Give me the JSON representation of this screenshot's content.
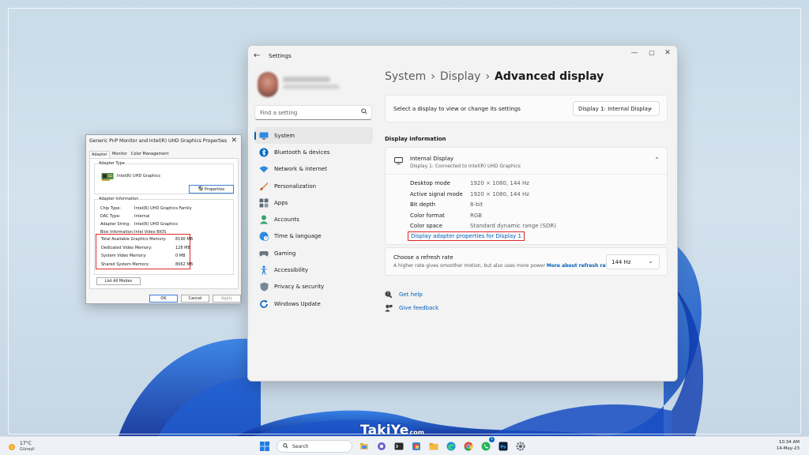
{
  "settings": {
    "title": "Settings",
    "search_placeholder": "Find a setting",
    "nav": [
      {
        "label": "System",
        "icon": "system-monitor-icon",
        "active": true
      },
      {
        "label": "Bluetooth & devices",
        "icon": "bluetooth-icon"
      },
      {
        "label": "Network & internet",
        "icon": "wifi-icon"
      },
      {
        "label": "Personalization",
        "icon": "paintbrush-icon"
      },
      {
        "label": "Apps",
        "icon": "apps-icon"
      },
      {
        "label": "Accounts",
        "icon": "person-icon"
      },
      {
        "label": "Time & language",
        "icon": "globe-clock-icon"
      },
      {
        "label": "Gaming",
        "icon": "gamepad-icon"
      },
      {
        "label": "Accessibility",
        "icon": "accessibility-icon"
      },
      {
        "label": "Privacy & security",
        "icon": "shield-icon"
      },
      {
        "label": "Windows Update",
        "icon": "update-icon"
      }
    ],
    "breadcrumb": {
      "system": "System",
      "display": "Display",
      "current": "Advanced display",
      "separator": "›"
    },
    "select_display": {
      "label": "Select a display to view or change its settings",
      "value": "Display 1: Internal Display"
    },
    "display_info": {
      "section_title": "Display information",
      "name": "Internal Display",
      "connection": "Display 1: Connected to Intel(R) UHD Graphics",
      "rows": [
        {
          "key": "Desktop mode",
          "value": "1920 × 1080, 144 Hz"
        },
        {
          "key": "Active signal mode",
          "value": "1920 × 1080, 144 Hz"
        },
        {
          "key": "Bit depth",
          "value": "8-bit"
        },
        {
          "key": "Color format",
          "value": "RGB"
        },
        {
          "key": "Color space",
          "value": "Standard dynamic range (SDR)"
        }
      ],
      "adapter_link": "Display adapter properties for Display 1"
    },
    "refresh": {
      "title": "Choose a refresh rate",
      "description": "A higher rate gives smoother motion, but also uses more power",
      "link": "More about refresh rate",
      "value": "144 Hz"
    },
    "help": {
      "get_help": "Get help",
      "feedback": "Give feedback"
    },
    "accent_color": "#005fb8"
  },
  "dialog": {
    "title": "Generic PnP Monitor and Intel(R) UHD Graphics Properties",
    "tabs": [
      "Adapter",
      "Monitor",
      "Color Management"
    ],
    "adapter_type_label": "Adapter Type",
    "adapter_type_value": "Intel(R) UHD Graphics",
    "properties_button": "Properties",
    "adapter_info_label": "Adapter Information",
    "info_rows": [
      {
        "key": "Chip Type:",
        "value": "Intel(R) UHD Graphics Family"
      },
      {
        "key": "DAC Type:",
        "value": "Internal"
      },
      {
        "key": "Adapter String:",
        "value": "Intel(R) UHD Graphics"
      },
      {
        "key": "Bios Information:",
        "value": "Intel Video BIOS"
      }
    ],
    "memory_rows": [
      {
        "key": "Total Available Graphics Memory:",
        "value": "8190 MB"
      },
      {
        "key": "Dedicated Video Memory:",
        "value": "128 MB"
      },
      {
        "key": "System Video Memory:",
        "value": "0 MB"
      },
      {
        "key": "Shared System Memory:",
        "value": "8062 MB"
      }
    ],
    "list_all_modes": "List All Modes",
    "ok": "OK",
    "cancel": "Cancel",
    "apply": "Apply",
    "highlight_color": "#e02a2a"
  },
  "taskbar": {
    "weather": {
      "temp": "17°C",
      "condition": "Güneşli"
    },
    "search_label": "Search",
    "icons": [
      "windows-start-icon",
      "search-icon",
      "file-explorer-icon",
      "teams-chat-icon",
      "terminal-icon",
      "app-icon",
      "folder-icon",
      "edge-icon",
      "chrome-icon",
      "whatsapp-icon",
      "photoshop-icon",
      "settings-gear-icon"
    ],
    "whatsapp_badge": "1",
    "time": "10:34 AM",
    "date": "14-May-23"
  },
  "watermark": {
    "main": "TakiYe",
    "tld": "com"
  }
}
